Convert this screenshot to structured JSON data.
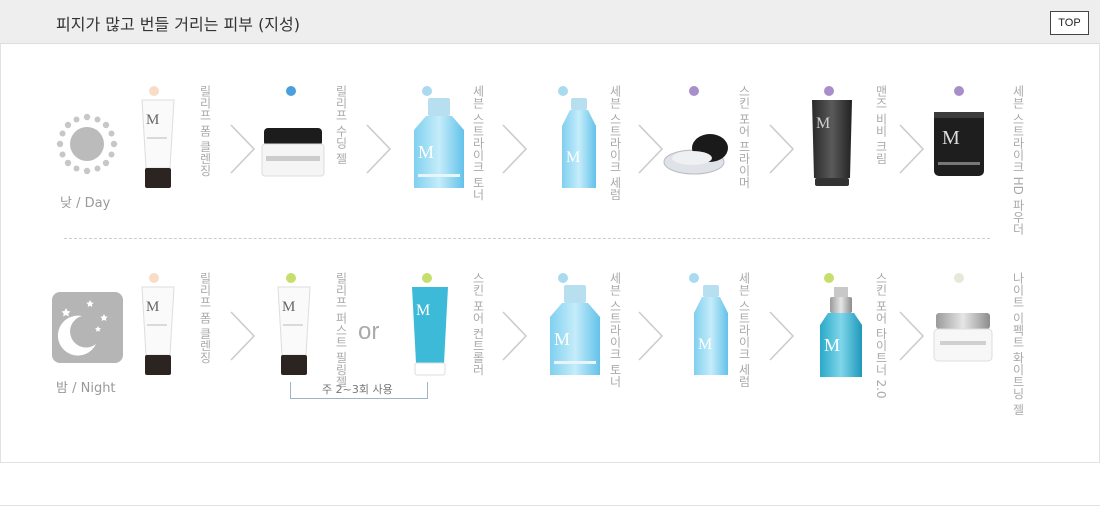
{
  "header": {
    "title": "피지가 많고 번들 거리는 피부 (지성)",
    "top_button": "TOP"
  },
  "colors": {
    "peach": "#f9dcc8",
    "blue": "#4a9fdc",
    "light_blue": "#a9daf0",
    "purple": "#a98fc9",
    "lime": "#c6df6c",
    "beige": "#e7e7da",
    "arrow": "#cccccc"
  },
  "day": {
    "label": "낮 / Day",
    "icon": "sun-icon",
    "steps": [
      {
        "name": "릴리프 폼 클렌징",
        "dot": "peach",
        "product": "foam-cleanser-tube"
      },
      {
        "name": "릴리프 수딩 젤",
        "dot": "blue",
        "product": "soothing-gel-jar"
      },
      {
        "name": "세븐 스트라이크 토너",
        "dot": "light_blue",
        "product": "toner-bottle"
      },
      {
        "name": "세븐 스트라이크 세럼",
        "dot": "light_blue",
        "product": "serum-bottle"
      },
      {
        "name": "스킨 포어 프라이머",
        "dot": "purple",
        "product": "pore-primer-compact"
      },
      {
        "name": "맨즈 비비 크림",
        "dot": "purple",
        "product": "bb-cream-tube"
      },
      {
        "name": "세븐 스트라이크 HD 파우더",
        "dot": "purple",
        "product": "hd-powder-jar"
      }
    ]
  },
  "night": {
    "label": "밤 / Night",
    "icon": "moon-icon",
    "steps": [
      {
        "name": "릴리프 폼 클렌징",
        "dot": "peach",
        "product": "foam-cleanser-tube"
      },
      {
        "name": "릴리프 퍼스트 필링젤",
        "dot": "lime",
        "product": "peeling-gel-tube"
      },
      {
        "name": "스킨 포어 컨트롤러",
        "dot": "lime",
        "product": "pore-controller-tube"
      },
      {
        "name": "세븐 스트라이크 토너",
        "dot": "light_blue",
        "product": "toner-bottle"
      },
      {
        "name": "세븐 스트라이크 세럼",
        "dot": "light_blue",
        "product": "serum-bottle"
      },
      {
        "name": "스킨 포어 타이트너 2.0",
        "dot": "lime",
        "product": "pore-tightener-pump"
      },
      {
        "name": "나이트 이펙트 화이트닝 젤",
        "dot": "beige",
        "product": "whitening-gel-jar"
      }
    ],
    "or_label": "or",
    "weekly_note": "주 2~3회 사용"
  }
}
